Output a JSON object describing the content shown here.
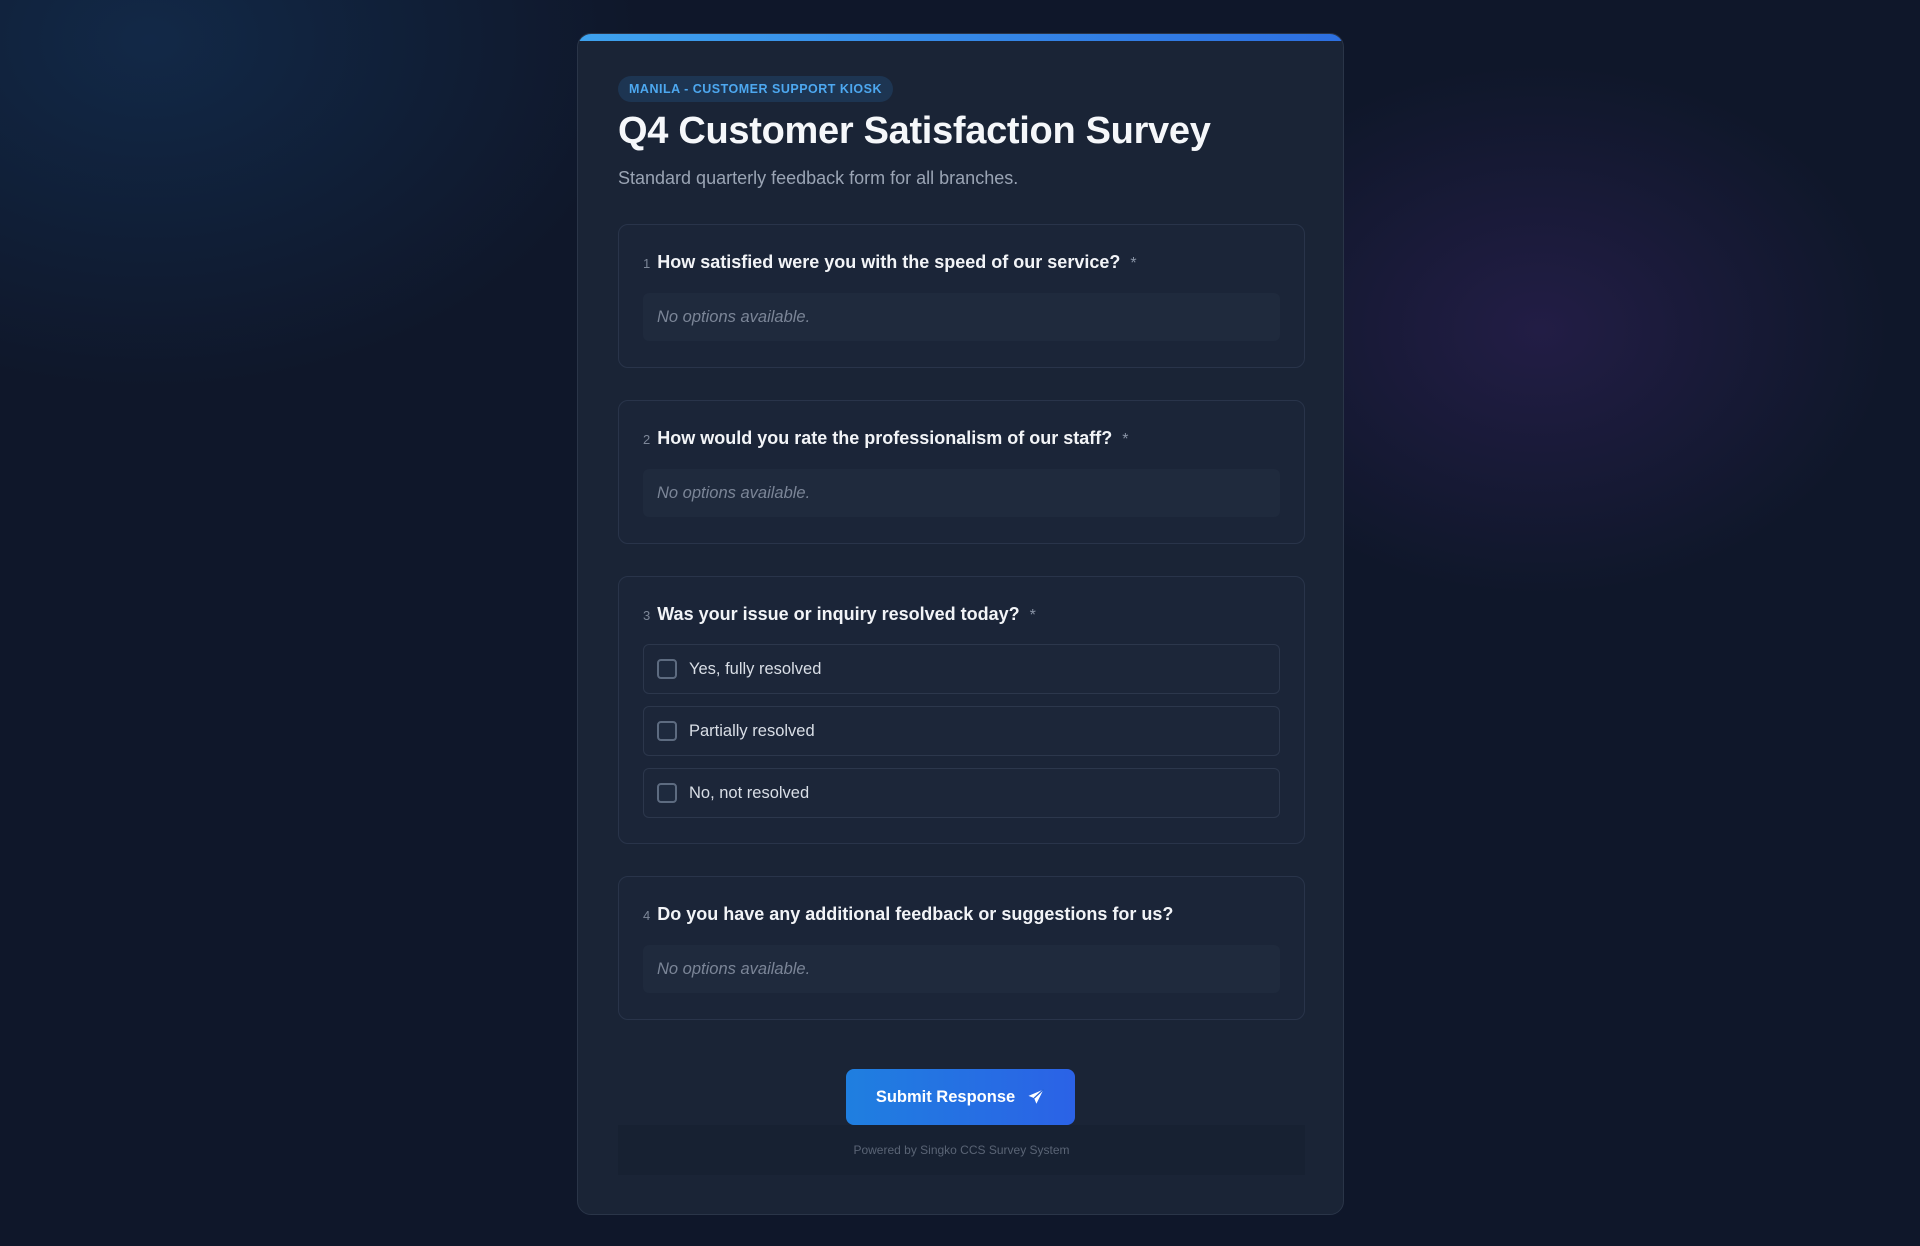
{
  "survey": {
    "badge": "MANILA - CUSTOMER SUPPORT KIOSK",
    "title": "Q4 Customer Satisfaction Survey",
    "subtitle": "Standard quarterly feedback form for all branches.",
    "questions": [
      {
        "number": "1",
        "text": "How satisfied were you with the speed of our service?",
        "required_marker": "*",
        "empty_text": "No options available."
      },
      {
        "number": "2",
        "text": "How would you rate the professionalism of our staff?",
        "required_marker": "*",
        "empty_text": "No options available."
      },
      {
        "number": "3",
        "text": "Was your issue or inquiry resolved today?",
        "required_marker": "*",
        "options": [
          "Yes, fully resolved",
          "Partially resolved",
          "No, not resolved"
        ]
      },
      {
        "number": "4",
        "text": "Do you have any additional feedback or suggestions for us?",
        "empty_text": "No options available."
      }
    ],
    "submit_label": "Submit Response",
    "footer": "Powered by Singko CCS Survey System"
  },
  "colors": {
    "accent": "#2d6fe0",
    "badge_text": "#4da8f0",
    "background": "#0f172a",
    "card": "#1a2436"
  },
  "icons": {
    "submit": "paper-plane-icon",
    "checkbox": "checkbox-unchecked-icon"
  }
}
